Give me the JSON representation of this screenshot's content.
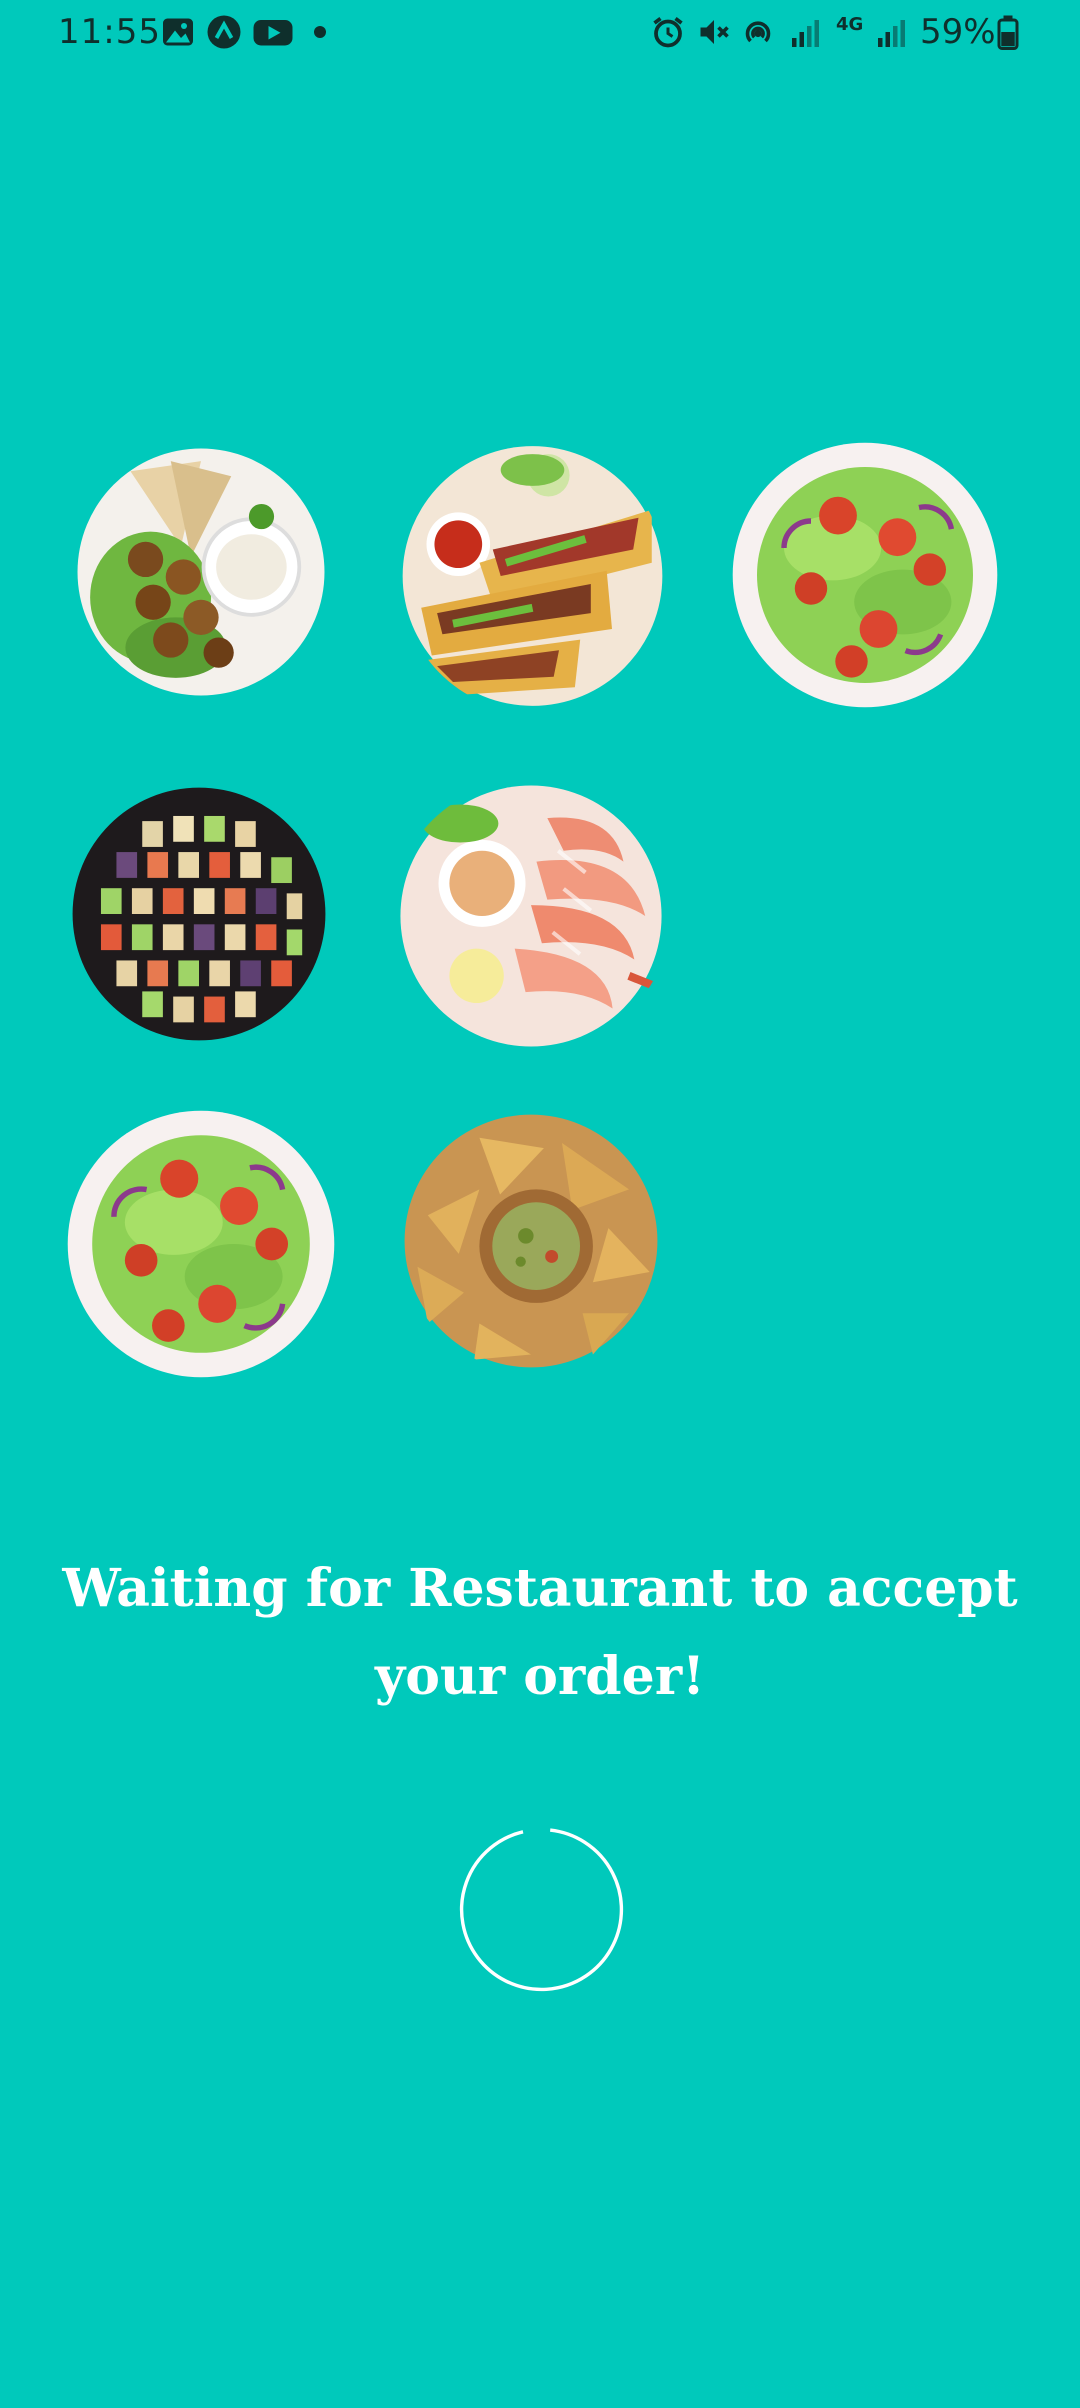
{
  "status_bar": {
    "time": "11:55",
    "network": "4G",
    "battery": "59%"
  },
  "icons": {
    "gallery": "image-icon",
    "app": "caret-up-icon",
    "youtube": "play-icon",
    "alarm": "alarm-icon",
    "mute": "mute-icon",
    "hotspot": "hotspot-icon",
    "signal": "signal-icon"
  },
  "dishes": [
    "falafel",
    "tacos",
    "salad",
    "sushi",
    "shrimp",
    "salad",
    "nachos"
  ],
  "message": {
    "text": "Waiting for Restaurant to accept your order!"
  },
  "colors": {
    "background": "#00C9BB",
    "text": "#FFFFFF",
    "spinner": "#FFFFFF"
  }
}
